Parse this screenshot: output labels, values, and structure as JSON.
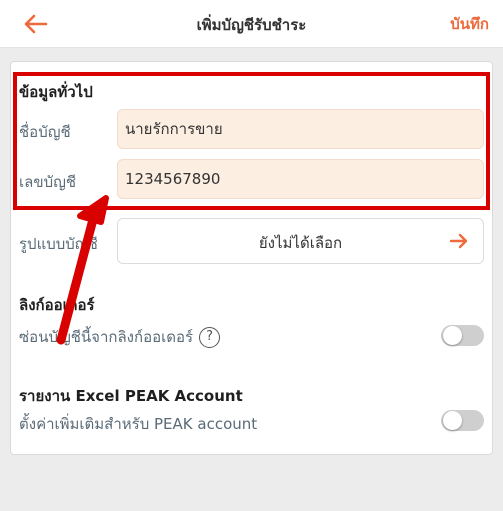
{
  "header": {
    "title": "เพิ่มบัญชีรับชำระ",
    "save_label": "บันทึก",
    "accent_color": "#ee6a3c"
  },
  "general": {
    "section_title": "ข้อมูลทั่วไป",
    "account_name_label": "ชื่อบัญชี",
    "account_name_value": "นายรักการขาย",
    "account_number_label": "เลขบัญชี",
    "account_number_value": "1234567890",
    "format_label": "รูปแบบบัญชี",
    "format_value": "ยังไม่ได้เลือก"
  },
  "order_link": {
    "section_title": "ลิงก์ออเดอร์",
    "hide_label": "ซ่อนบัญชีนี้จากลิงก์ออเดอร์",
    "help_icon": "?",
    "hide_enabled": false
  },
  "excel_report": {
    "section_title": "รายงาน Excel PEAK Account",
    "setting_label": "ตั้งค่าเพิ่มเติมสำหรับ PEAK account",
    "setting_enabled": false
  },
  "annotation": {
    "highlight_color": "#d90000"
  }
}
